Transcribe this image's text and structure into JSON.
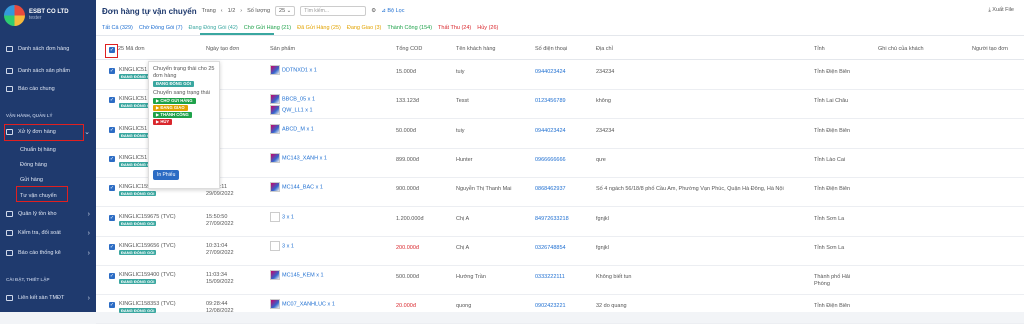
{
  "sidebar": {
    "brand": "ESBT CO LTD",
    "user": "tester",
    "items": [
      {
        "label": "Danh sách đơn hàng"
      },
      {
        "label": "Danh sách sản phẩm"
      },
      {
        "label": "Báo cáo chung"
      }
    ],
    "section1": "VẬN HÀNH, QUẢN LÝ",
    "orders": "Xử lý đơn hàng",
    "subs": [
      "Chuẩn bị hàng",
      "Đóng hàng",
      "Gửi hàng",
      "Tư vận chuyển"
    ],
    "items2": [
      {
        "label": "Quản lý tồn kho"
      },
      {
        "label": "Kiểm tra, đối soát"
      },
      {
        "label": "Báo cáo thống kê"
      }
    ],
    "section2": "CÀI ĐẶT, THIẾT LẬP",
    "items3": [
      {
        "label": "Liên kết sàn TMĐT"
      }
    ]
  },
  "topbar": {
    "title": "Đơn hàng tự vận chuyển",
    "page_label": "Trang",
    "page": "1/2",
    "qty_label": "Số lượng",
    "qty": "25",
    "search_placeholder": "Tìm kiếm...",
    "filter": "Bộ Lọc",
    "export": "Xuất File"
  },
  "tabs": [
    {
      "label": "Tất Cả (329)",
      "color": "#1f6fd1"
    },
    {
      "label": "Chờ Đóng Gói (7)",
      "color": "#1f6fd1"
    },
    {
      "label": "Đang Đóng Gói (42)",
      "color": "#3aa7a0"
    },
    {
      "label": "Chờ Gửi Hàng (21)",
      "color": "#1fa24a"
    },
    {
      "label": "Đã Gửi Hàng (25)",
      "color": "#e2a300"
    },
    {
      "label": "Đang Giao (3)",
      "color": "#e2a300"
    },
    {
      "label": "Thành Công (154)",
      "color": "#1fa24a"
    },
    {
      "label": "Thất Thu (24)",
      "color": "#d9262c"
    },
    {
      "label": "Hủy (26)",
      "color": "#d9262c"
    }
  ],
  "headers": {
    "order": "25 Mã đơn",
    "date": "Ngày tạo đơn",
    "product": "Sản phẩm",
    "cod": "Tổng COD",
    "customer": "Tên khách hàng",
    "phone": "Số điện thoại",
    "address": "Địa chỉ",
    "province": "Tỉnh",
    "note": "Ghi chú của khách",
    "creator": "Người tạo đơn"
  },
  "status_badge": "ĐANG ĐÓNG GÓI",
  "rows": [
    {
      "order": "KINGLIC51",
      "time": ":04",
      "date": "/2022",
      "products": [
        "DDTNXD1 x 1"
      ],
      "cod": "15.000đ",
      "customer": "tuiy",
      "phone": "0944023424",
      "address": "234234",
      "province": "Tỉnh Điện Biên"
    },
    {
      "order": "KINGLIC51",
      "time": ":29",
      "date": "/2022",
      "products": [
        "BBCB_05 x 1",
        "QW_LL1 x 1"
      ],
      "cod": "133.123đ",
      "customer": "Tesst",
      "phone": "0123456789",
      "address": "không",
      "province": "Tỉnh Lai Châu"
    },
    {
      "order": "KINGLIC51",
      "time": ":56",
      "date": "/2022",
      "products": [
        "ABCD_M x 1"
      ],
      "cod": "50.000đ",
      "customer": "tuiy",
      "phone": "0944023424",
      "address": "234234",
      "province": "Tỉnh Điện Biên"
    },
    {
      "order": "KINGLIC51",
      "time": ":10",
      "date": "/2022",
      "products": [
        "MC143_XANH x 1"
      ],
      "cod": "899.000đ",
      "customer": "Hunter",
      "phone": "0966666666",
      "address": "qưe",
      "province": "Tỉnh Lào Cai"
    },
    {
      "order": "KINGLIC159787 (eStore)",
      "time": "10:39:11",
      "date": "29/09/2022",
      "products": [
        "MC144_BAC x 1"
      ],
      "cod": "900.000đ",
      "customer": "Nguyễn Thị Thanh Mai",
      "phone": "0868462937",
      "address": "Số 4 ngách 56/18/8 phố Cầu Am, Phường Vạn Phúc, Quận Hà Đông, Hà Nội",
      "province": "Tỉnh Điện Biên"
    },
    {
      "order": "KINGLIC159675 (TVC)",
      "time": "15:50:50",
      "date": "27/09/2022",
      "products": [
        "3 x 1"
      ],
      "cod": "1.200.000đ",
      "customer": "Chị A",
      "phone": "84972633218",
      "address": "fgnjkl",
      "province": "Tỉnh Sơn La"
    },
    {
      "order": "KINGLIC159656 (TVC)",
      "time": "10:31:04",
      "date": "27/09/2022",
      "products": [
        "3 x 1"
      ],
      "cod": "200.000đ",
      "cod_red": true,
      "customer": "Chị A",
      "phone": "0326748854",
      "address": "fgnjkl",
      "province": "Tỉnh Sơn La"
    },
    {
      "order": "KINGLIC159400 (TVC)",
      "time": "11:03:34",
      "date": "15/09/2022",
      "products": [
        "MC145_KEM x 1"
      ],
      "cod": "500.000đ",
      "customer": "Hướng Trần",
      "phone": "0333222111",
      "address": "Không biết tun",
      "province": "Thành phố Hải Phòng"
    },
    {
      "order": "KINGLIC158353 (TVC)",
      "time": "09:28:44",
      "date": "12/08/2022",
      "products": [
        "MC07_XANHLUC x 1"
      ],
      "cod": "20.000đ",
      "cod_red": true,
      "customer": "quong",
      "phone": "0902423221",
      "address": "32 do quang",
      "province": "Tỉnh Điện Biên"
    }
  ],
  "popup": {
    "label1": "Chuyển trạng thái cho 25 đơn hàng",
    "badge1": "ĐANG ĐÓNG GÓI",
    "label2": "Chuyển sang trạng thái",
    "opts": [
      {
        "label": "▶ CHỜ GỬI HÀNG",
        "color": "#1fa24a"
      },
      {
        "label": "▶ ĐANG GIAO",
        "color": "#e2a300"
      },
      {
        "label": "▶ THÀNH CÔNG",
        "color": "#1fa24a"
      },
      {
        "label": "▶ HỦY",
        "color": "#d9262c"
      }
    ],
    "print": "In Phiếu"
  }
}
